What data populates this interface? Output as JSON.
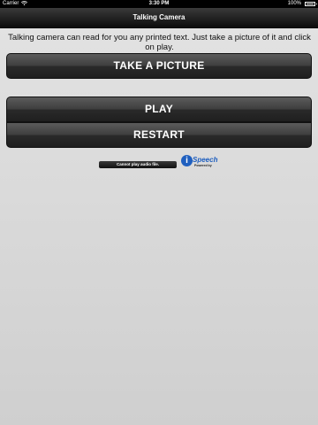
{
  "status_bar": {
    "carrier": "Carrier",
    "time": "3:30 PM",
    "battery_percent": "100%"
  },
  "nav": {
    "title": "Talking Camera"
  },
  "intro_text": "Talking camera can read for you any printed text. Just take a picture of it and click on play.",
  "buttons": {
    "take_picture": "TAKE A PICTURE",
    "play": "PLAY",
    "restart": "RESTART"
  },
  "audio_status": "Cannot play audio file.",
  "ispeech": {
    "logo_glyph": "i",
    "brand": "Speech",
    "powered_by": "Powered by"
  }
}
